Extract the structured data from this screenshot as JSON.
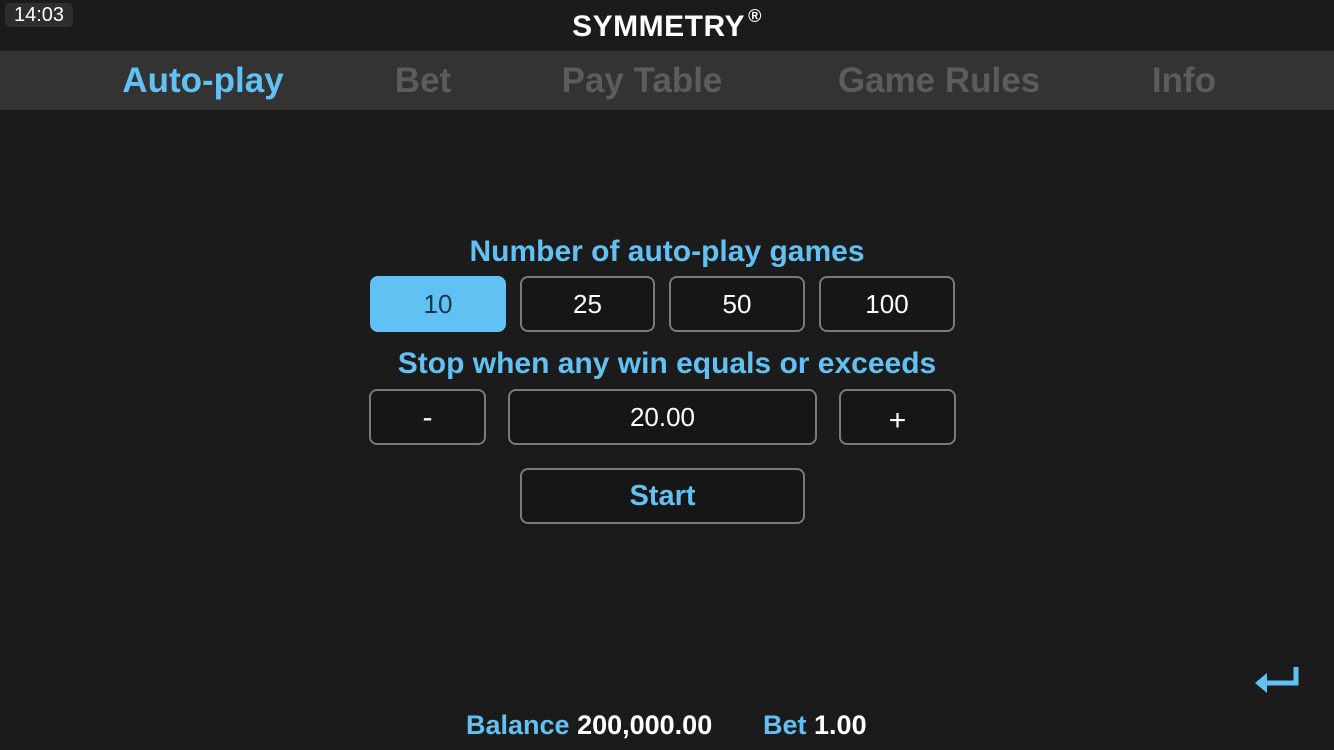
{
  "status_bar": {
    "time": "14:03"
  },
  "app": {
    "title": "SYMMETRY",
    "trademark": "®"
  },
  "tabs": [
    {
      "label": "Auto-play",
      "active": true
    },
    {
      "label": "Bet",
      "active": false
    },
    {
      "label": "Pay Table",
      "active": false
    },
    {
      "label": "Game Rules",
      "active": false
    },
    {
      "label": "Info",
      "active": false
    }
  ],
  "autoplay": {
    "games_label": "Number of auto-play games",
    "game_options": [
      "10",
      "25",
      "50",
      "100"
    ],
    "selected_games": "10",
    "stop_label": "Stop when any win equals or exceeds",
    "decrease_label": "-",
    "stop_value": "20.00",
    "increase_label": "+",
    "start_label": "Start"
  },
  "footer": {
    "balance_label": "Balance",
    "balance_value": "200,000.00",
    "bet_label": "Bet",
    "bet_value": "1.00"
  },
  "colors": {
    "accent": "#62c1f3",
    "background": "#1b1b1b",
    "tab_bar": "#333333",
    "inactive_tab": "#5c5c5c"
  },
  "icons": {
    "back": "enter-return-icon"
  }
}
